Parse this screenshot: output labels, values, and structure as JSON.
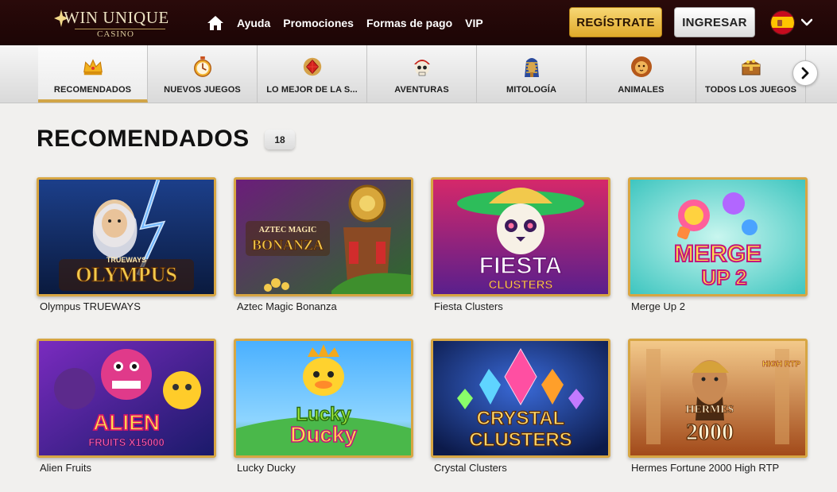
{
  "brand": {
    "name": "WIN UNIQUE",
    "sub": "CASINO"
  },
  "nav": {
    "home_icon": "home-icon",
    "links": [
      "Ayuda",
      "Promociones",
      "Formas de pago",
      "VIP"
    ]
  },
  "auth": {
    "register_label": "REGÍSTRATE",
    "login_label": "INGRESAR"
  },
  "language": {
    "flag": "spain-flag",
    "icon": "chevron-down-icon"
  },
  "categories": [
    {
      "label": "RECOMENDADOS",
      "icon": "crown-icon",
      "active": true
    },
    {
      "label": "NUEVOS JUEGOS",
      "icon": "stopwatch-icon",
      "active": false
    },
    {
      "label": "LO MEJOR DE LA S...",
      "icon": "gem-icon",
      "active": false
    },
    {
      "label": "AVENTURAS",
      "icon": "pirate-skull-icon",
      "active": false
    },
    {
      "label": "MITOLOGÍA",
      "icon": "pharaoh-icon",
      "active": false
    },
    {
      "label": "ANIMALES",
      "icon": "lion-icon",
      "active": false
    },
    {
      "label": "TODOS LOS JUEGOS",
      "icon": "treasure-chest-icon",
      "active": false
    }
  ],
  "section": {
    "title": "RECOMENDADOS",
    "count": "18"
  },
  "games": [
    {
      "title": "Olympus TRUEWAYS",
      "art": "OLYMPUS",
      "art_sub": "TRUEWAYS"
    },
    {
      "title": "Aztec Magic Bonanza",
      "art": "BONANZA",
      "art_sub": "AZTEC MAGIC"
    },
    {
      "title": "Fiesta Clusters",
      "art": "FIESTA",
      "art_sub": "CLUSTERS"
    },
    {
      "title": "Merge Up 2",
      "art": "MERGE",
      "art_sub": "UP 2"
    },
    {
      "title": "Alien Fruits",
      "art": "ALIEN",
      "art_sub": "FRUITS X15000"
    },
    {
      "title": "Lucky Ducky",
      "art": "Lucky",
      "art_sub": "Ducky"
    },
    {
      "title": "Crystal Clusters",
      "art": "CRYSTAL",
      "art_sub": "CLUSTERS"
    },
    {
      "title": "Hermes Fortune 2000 High RTP",
      "art": "2000",
      "art_sub": "HERMES",
      "badge": "HIGH RTP"
    }
  ]
}
